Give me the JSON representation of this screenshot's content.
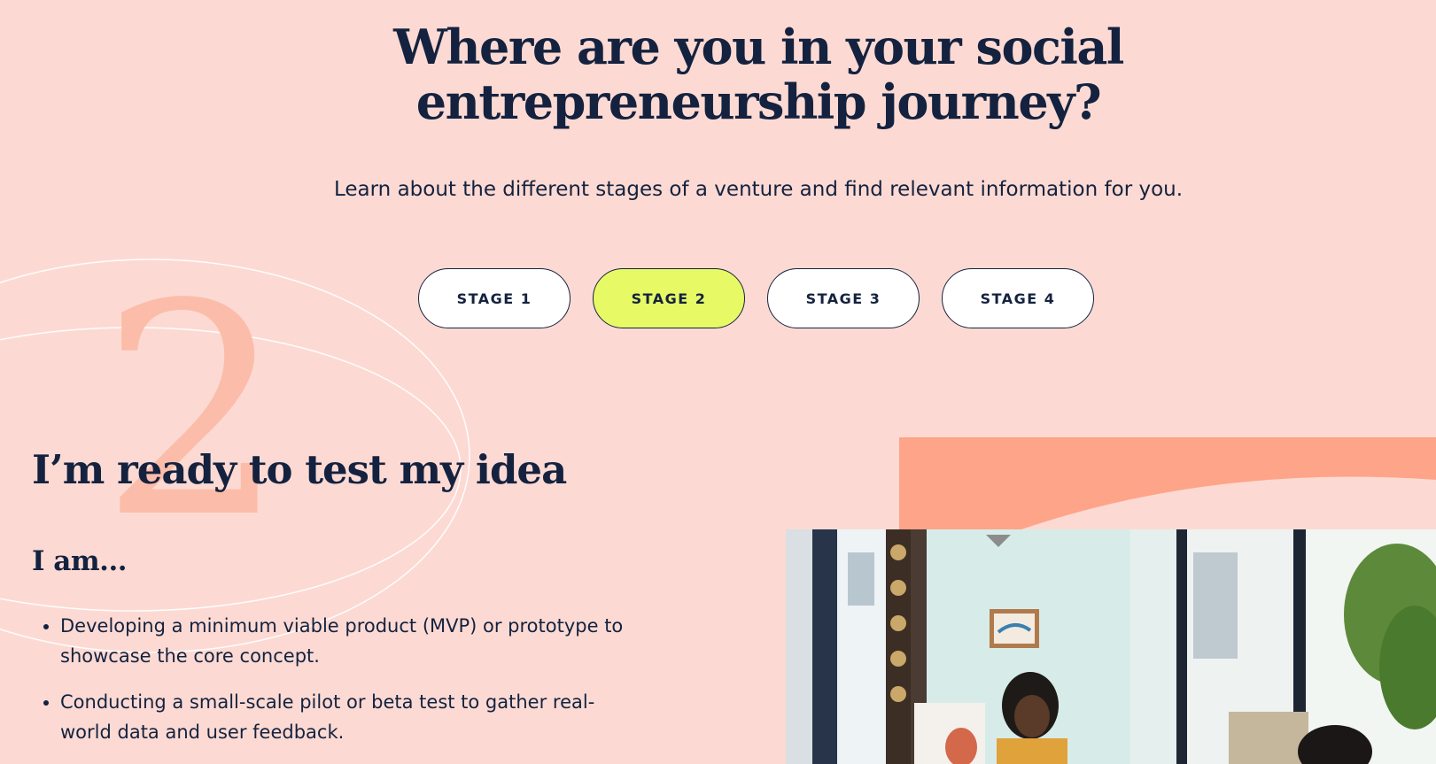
{
  "header": {
    "title_line1": "Where are you in your social",
    "title_line2": "entrepreneurship journey?",
    "subtitle": "Learn about the different stages of a venture and find relevant information for you."
  },
  "stage_tabs": [
    {
      "label": "STAGE 1",
      "active": false
    },
    {
      "label": "STAGE 2",
      "active": true
    },
    {
      "label": "STAGE 3",
      "active": false
    },
    {
      "label": "STAGE 4",
      "active": false
    }
  ],
  "stage_section": {
    "stage_number": "2",
    "heading": "I’m ready to test my idea",
    "subheading": "I am...",
    "bullets": [
      "Developing a minimum viable product (MVP) or prototype to showcase the core concept.",
      "Conducting a small-scale pilot or beta test to gather real-world data and user feedback."
    ]
  },
  "colors": {
    "background": "#fcdad3",
    "navy": "#14223f",
    "active_tab": "#e7fa65",
    "stage_number": "#fbbda9",
    "accent_shape": "#fea489"
  }
}
